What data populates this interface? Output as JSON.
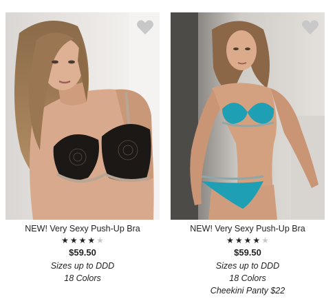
{
  "colors": {
    "heart_fill": "#c8c8c8",
    "star_on": "#222222",
    "star_off": "#c9c9c9"
  },
  "products": [
    {
      "image_alt": "Model wearing black lace push-up bra",
      "favorite_icon": "heart-icon",
      "name": "NEW! Very Sexy Push-Up Bra",
      "rating": 4,
      "rating_max": 5,
      "price": "$59.50",
      "details": [
        "Sizes up to DDD",
        "18 Colors"
      ]
    },
    {
      "image_alt": "Model wearing teal lace push-up bra and panty",
      "favorite_icon": "heart-icon",
      "name": "NEW! Very Sexy Push-Up Bra",
      "rating": 4,
      "rating_max": 5,
      "price": "$59.50",
      "details": [
        "Sizes up to DDD",
        "18 Colors",
        "Cheekini Panty $22"
      ]
    }
  ]
}
